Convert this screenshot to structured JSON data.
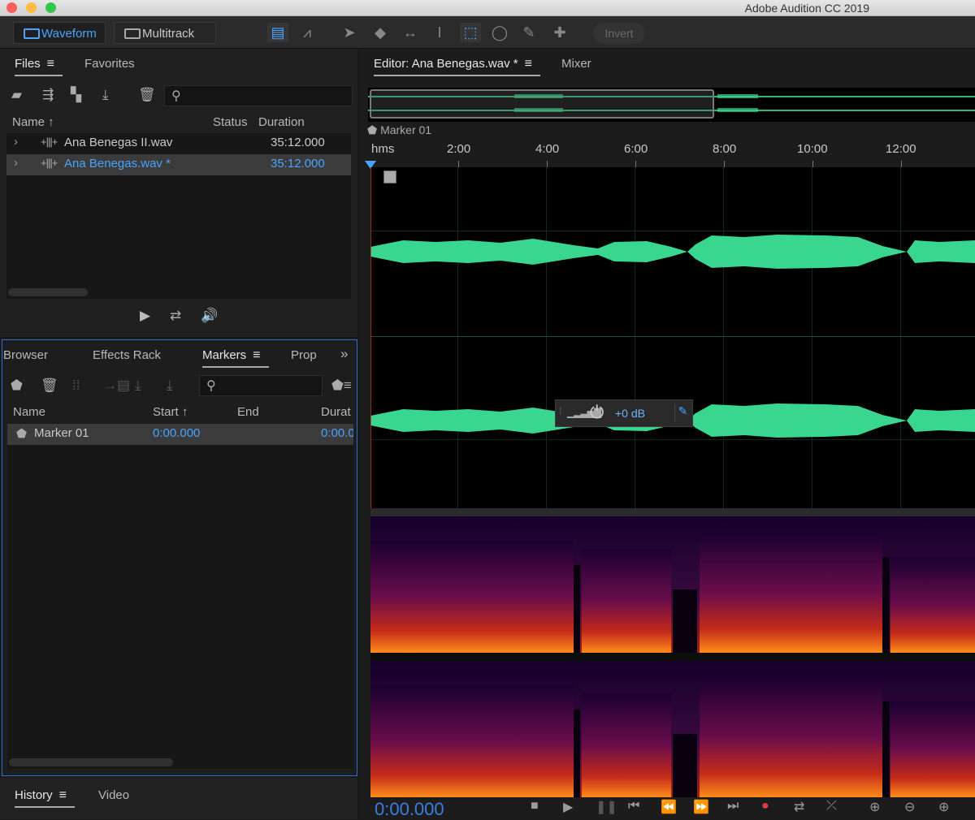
{
  "window": {
    "title": "Adobe Audition CC 2019"
  },
  "toolbar": {
    "waveform_label": "Waveform",
    "multitrack_label": "Multitrack",
    "invert_label": "Invert"
  },
  "files_panel": {
    "tabs": [
      "Files",
      "Favorites"
    ],
    "columns": {
      "name": "Name",
      "status": "Status",
      "duration": "Duration"
    },
    "files": [
      {
        "name": "Ana Benegas II.wav",
        "duration": "35:12.000",
        "selected": false
      },
      {
        "name": "Ana Benegas.wav *",
        "duration": "35:12.000",
        "selected": true
      }
    ]
  },
  "markers_panel": {
    "tabs": [
      "Browser",
      "Effects Rack",
      "Markers",
      "Prop"
    ],
    "columns": {
      "name": "Name",
      "start": "Start",
      "end": "End",
      "duration": "Durat"
    },
    "markers": [
      {
        "name": "Marker 01",
        "start": "0:00.000",
        "duration": "0:00.0"
      }
    ]
  },
  "bottom_panel": {
    "tabs": [
      "History",
      "Video"
    ]
  },
  "editor": {
    "tabs": [
      "Editor: Ana Benegas.wav *",
      "Mixer"
    ],
    "marker_label": "Marker 01",
    "ruler": [
      "hms",
      "2:00",
      "4:00",
      "6:00",
      "8:00",
      "10:00",
      "12:00"
    ],
    "hud_gain": "+0 dB",
    "current_time": "0:00.000"
  },
  "colors": {
    "accent": "#4aa3ff",
    "waveform": "#39d68f",
    "panel_focus": "#2d6fd1"
  }
}
